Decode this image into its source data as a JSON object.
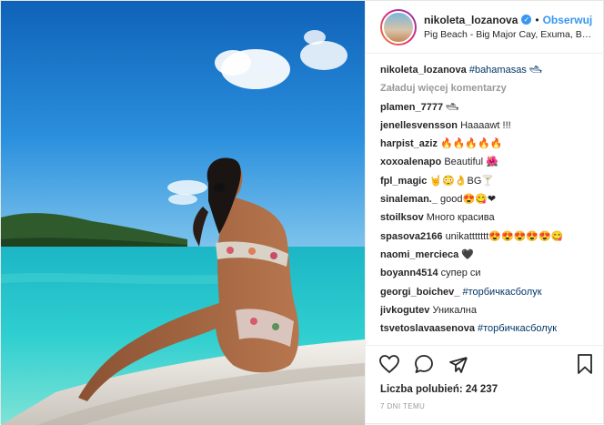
{
  "header": {
    "username": "nikoleta_lozanova",
    "verified_icon": "verified-badge-icon",
    "follow_label": "Obserwuj",
    "separator": "•",
    "location": "Pig Beach - Big Major Cay, Exuma, Baha..."
  },
  "caption": {
    "username": "nikoleta_lozanova",
    "text": "#bahamasas 🛥"
  },
  "load_more": "Załaduj więcej komentarzy",
  "comments": [
    {
      "user": "plamen_7777",
      "text": "🛥"
    },
    {
      "user": "jenellesvensson",
      "text": "Haaaawt !!!"
    },
    {
      "user": "harpist_aziz",
      "text": "🔥🔥🔥🔥🔥"
    },
    {
      "user": "xoxoalenapo",
      "text": "Beautiful 🌺"
    },
    {
      "user": "fpl_magic",
      "text": "🤘😳👌BG🍸"
    },
    {
      "user": "sinaleman._",
      "text": "good😍😋❤"
    },
    {
      "user": "stoilksov",
      "text": "Много красива"
    },
    {
      "user": "spasova2166",
      "text": "unikattttttt😍😍😍😍😍😋"
    },
    {
      "user": "naomi_mercieca",
      "text": "🖤"
    },
    {
      "user": "boyann4514",
      "text": "супер си"
    },
    {
      "user": "georgi_boichev_",
      "text": "#торбичкасболук"
    },
    {
      "user": "jivkogutev",
      "text": "Уникална"
    },
    {
      "user": "tsvetoslavaasenova",
      "text": "#торбичкасболук"
    }
  ],
  "actions": {
    "like_icon": "heart-icon",
    "comment_icon": "comment-icon",
    "share_icon": "share-icon",
    "save_icon": "bookmark-icon"
  },
  "likes": "Liczba polubień: 24 237",
  "time": "7 DNI TEMU",
  "colors": {
    "link": "#3897f0",
    "hashtag": "#003569",
    "muted": "#999999"
  }
}
